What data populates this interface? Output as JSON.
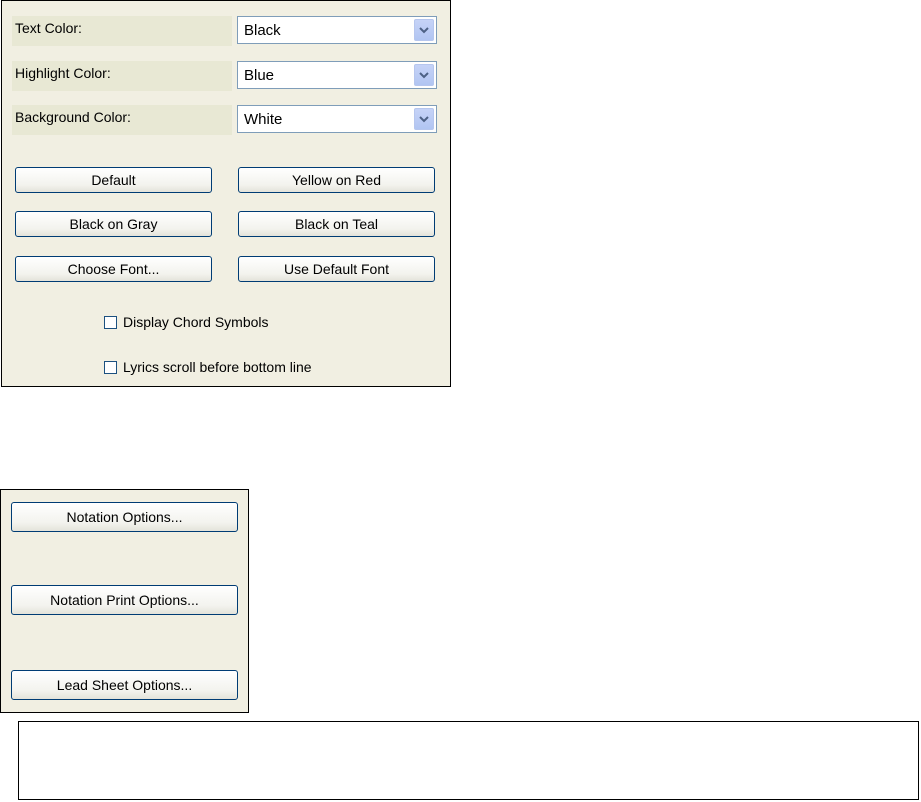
{
  "display_options": {
    "text_color": {
      "label": "Text Color:",
      "value": "Black"
    },
    "highlight_color": {
      "label": "Highlight Color:",
      "value": "Blue"
    },
    "background_color": {
      "label": "Background Color:",
      "value": "White"
    },
    "buttons": {
      "default": "Default",
      "yellow_on_red": "Yellow on Red",
      "black_on_gray": "Black on Gray",
      "black_on_teal": "Black on Teal",
      "choose_font": "Choose Font...",
      "use_default_font": "Use Default Font"
    },
    "checkboxes": {
      "display_chord_symbols": {
        "label": "Display Chord Symbols",
        "checked": false
      },
      "lyrics_scroll": {
        "label": "Lyrics scroll before bottom line",
        "checked": false
      }
    }
  },
  "notation_panel": {
    "notation_options": "Notation Options...",
    "notation_print_options": "Notation Print Options...",
    "lead_sheet_options": "Lead Sheet Options..."
  },
  "colors": {
    "panel_background": "#f1efe2",
    "label_background": "#e8e8d4",
    "button_border": "#003c74",
    "dropdown_arrow": "#4d6185"
  }
}
